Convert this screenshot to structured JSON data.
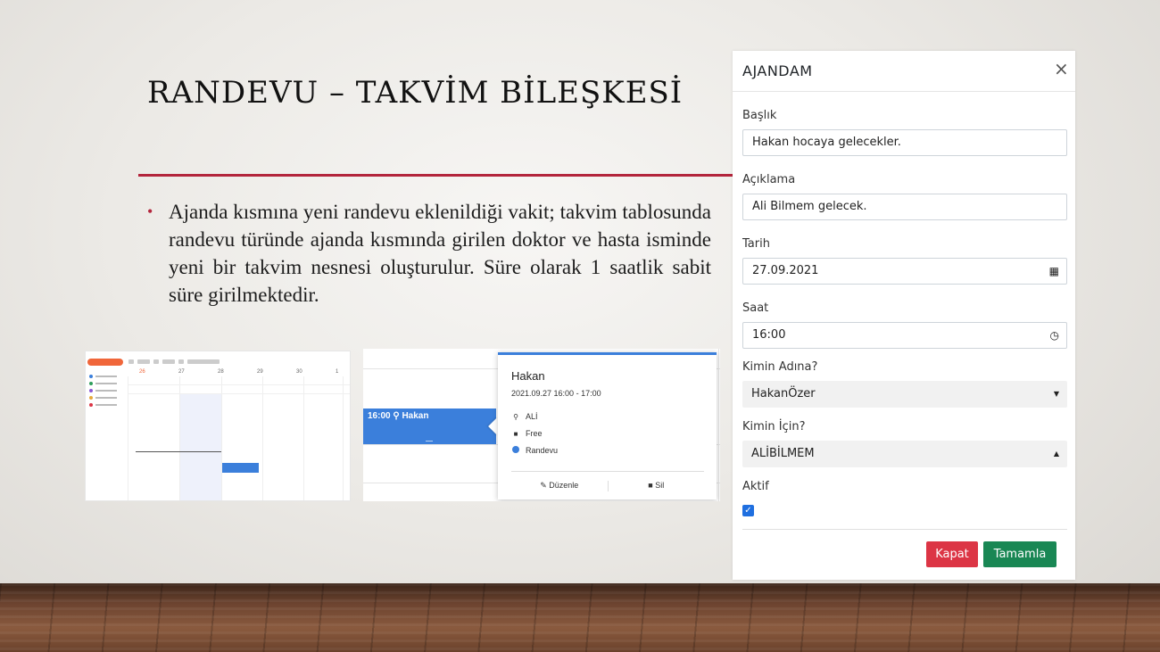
{
  "slide": {
    "title": "RANDEVU – TAKVİM BİLEŞKESİ",
    "bullet": "Ajanda kısmına yeni randevu eklenildiği vakit; takvim tablosunda randevu türünde ajanda kısmında girilen doktor ve hasta isminde yeni bir takvim nesnesi oluşturulur. Süre olarak 1 saatlik sabit süre girilmektedir."
  },
  "thumb1": {
    "days": [
      "26",
      "27",
      "28",
      "29",
      "30",
      "1"
    ],
    "today_color": "#f0663a"
  },
  "thumb2": {
    "event_label": "16:00 ⚲ Hakan",
    "popup": {
      "title": "Hakan",
      "time": "2021.09.27 16:00 - 17:00",
      "location": "ALİ",
      "status": "Free",
      "type": "Randevu",
      "edit": "Düzenle",
      "delete": "Sil"
    }
  },
  "modal": {
    "title": "AJANDAM",
    "fields": {
      "baslik_label": "Başlık",
      "baslik_value": "Hakan hocaya gelecekler.",
      "aciklama_label": "Açıklama",
      "aciklama_value": "Ali Bilmem gelecek.",
      "tarih_label": "Tarih",
      "tarih_value": "27.09.2021",
      "saat_label": "Saat",
      "saat_value": "16:00",
      "kimin_adina_label": "Kimin Adına?",
      "kimin_adina_value": "HakanÖzer",
      "kimin_icin_label": "Kimin İçin?",
      "kimin_icin_value": "ALİBİLMEM",
      "aktif_label": "Aktif",
      "aktif_checked": true
    },
    "buttons": {
      "kapat": "Kapat",
      "tamamla": "Tamamla"
    },
    "colors": {
      "danger": "#dc3545",
      "success": "#198754",
      "checkbox": "#1f6fe0"
    }
  }
}
